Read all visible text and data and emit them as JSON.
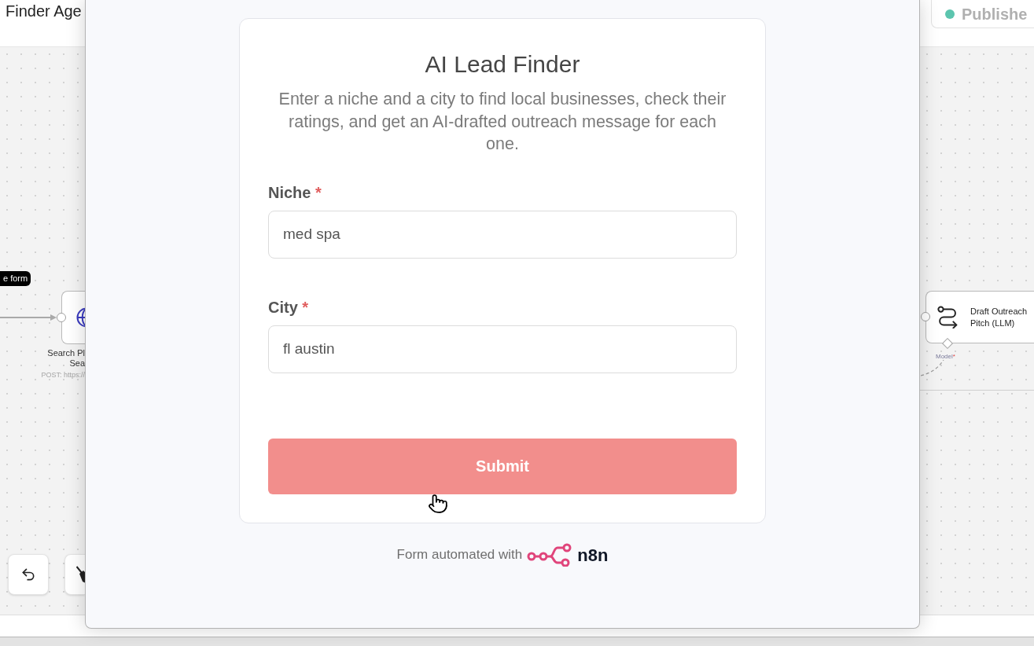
{
  "editor": {
    "workflow_title": "Finder Age",
    "status": {
      "label": "Publishe",
      "active": true
    }
  },
  "canvas": {
    "tooltip": "e form",
    "nodes": [
      {
        "kind": "http",
        "label_lines": [
          "Search Pl",
          "Sea"
        ],
        "subtitle": "POST: https://"
      },
      {
        "kind": "llm",
        "label_lines": [
          "Draft Outreach",
          "Pitch (LLM)"
        ],
        "input_label": "Model",
        "input_required_mark": "*"
      }
    ],
    "controls": [
      {
        "kind": "undo"
      },
      {
        "kind": "clear"
      }
    ]
  },
  "form": {
    "title": "AI Lead Finder",
    "description": "Enter a niche and a city to find local businesses, check their ratings, and get an AI-drafted outreach message for each one.",
    "fields": [
      {
        "label": "Niche",
        "required_mark": "*",
        "value": "med spa"
      },
      {
        "label": "City",
        "required_mark": "*",
        "value": "fl austin"
      }
    ],
    "submit": "Submit"
  },
  "footer": {
    "text": "Form automated with",
    "brand": "n8n"
  }
}
